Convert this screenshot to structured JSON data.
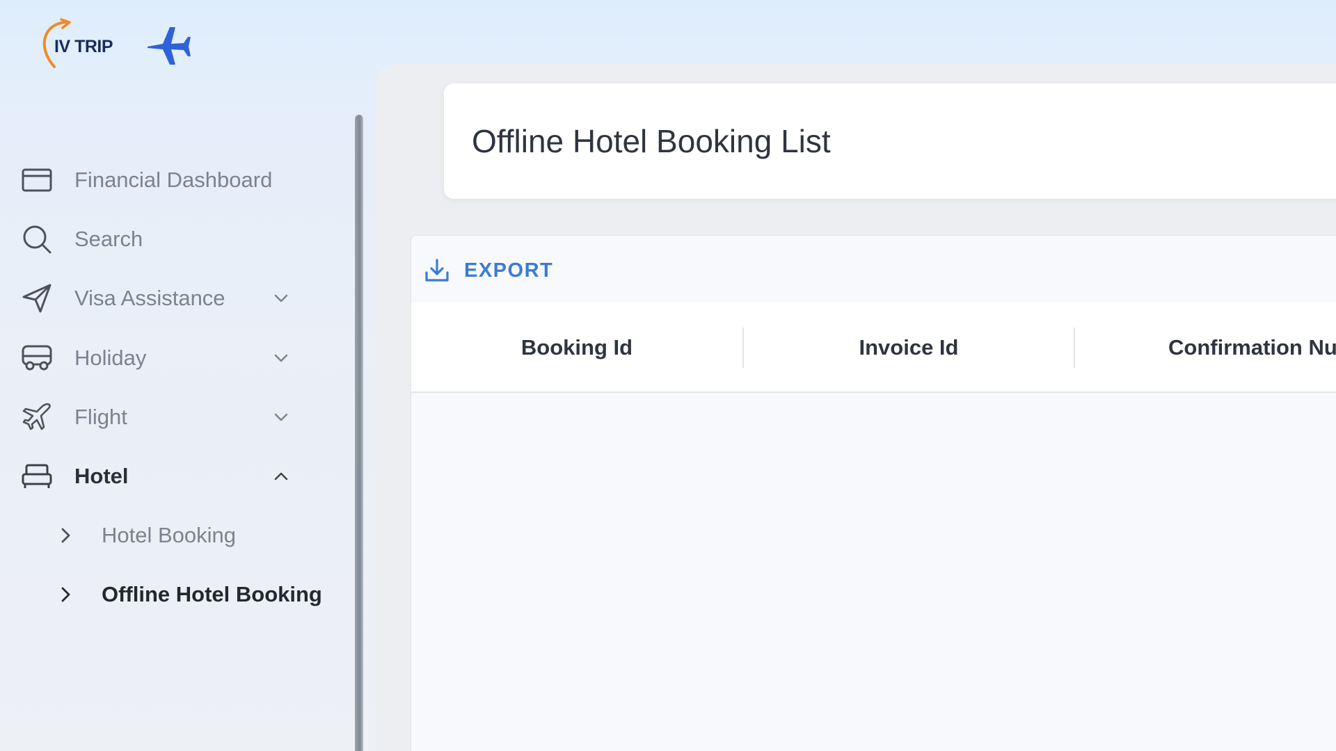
{
  "brand": {
    "name": "IV TRIP"
  },
  "sidebar": {
    "items": [
      {
        "label": "Financial Dashboard",
        "icon": "credit-card-icon",
        "expandable": false
      },
      {
        "label": "Search",
        "icon": "search-icon",
        "expandable": false
      },
      {
        "label": "Visa Assistance",
        "icon": "send-icon",
        "expandable": true,
        "state": "collapsed"
      },
      {
        "label": "Holiday",
        "icon": "bus-icon",
        "expandable": true,
        "state": "collapsed"
      },
      {
        "label": "Flight",
        "icon": "airplane-icon",
        "expandable": true,
        "state": "collapsed"
      },
      {
        "label": "Hotel",
        "icon": "bed-icon",
        "expandable": true,
        "state": "expanded",
        "active": true
      }
    ],
    "hotel_children": [
      {
        "label": "Hotel Booking"
      },
      {
        "label": "Offline Hotel Booking",
        "active": true
      }
    ]
  },
  "page": {
    "title": "Offline Hotel Booking List"
  },
  "toolbar": {
    "export_label": "EXPORT"
  },
  "grid": {
    "columns": [
      "Booking Id",
      "Invoice Id",
      "Confirmation Number"
    ],
    "rows": []
  },
  "colors": {
    "accent": "#3b7bd4",
    "brand_navy": "#1b2a5e",
    "brand_orange": "#f08a24",
    "plane_blue": "#2f62d8",
    "text_muted": "#7b8290",
    "text_active": "#23272e"
  }
}
